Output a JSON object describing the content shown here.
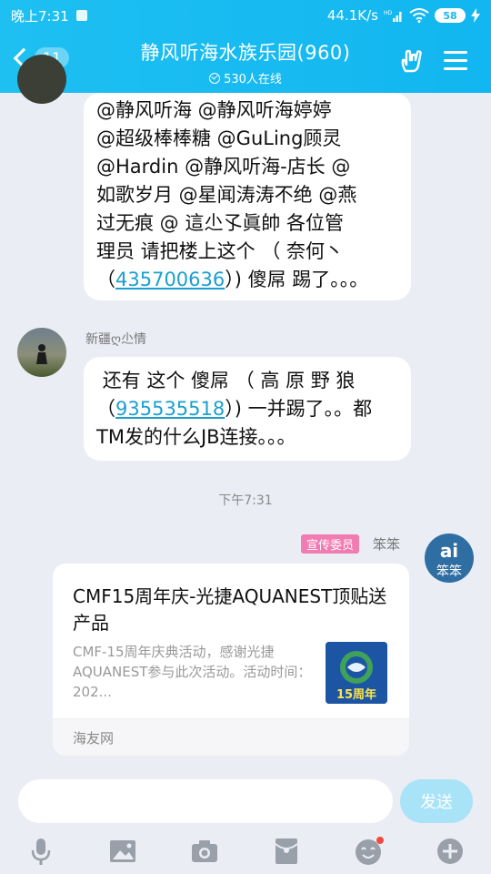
{
  "status_bar": {
    "time": "晚上7:31",
    "net_speed": "44.1K/s",
    "battery": "58"
  },
  "header": {
    "back_badge": "11",
    "title": "静风听海水族乐园(960)",
    "online": "530人在线"
  },
  "messages": [
    {
      "lines": [
        "@静风听海 @静风听海婷婷",
        "@超级棒棒糖 @GuLing顾灵",
        "@Hardin @静风听海-店长 @",
        "如歌岁月 @星闻涛涛不绝 @燕",
        "过无痕 @ 這尐孓眞帥   各位管",
        "理员 请把楼上这个 （ 奈何丶"
      ],
      "last_prefix": "（",
      "link": "435700636",
      "last_suffix": "）) 傻屌 踢了。。。"
    },
    {
      "sender": "新疆ღ尐情",
      "line1_prefix": "还有 这个 傻屌 （ 高 原 野 狼",
      "line2_prefix": "（",
      "link": "935535518",
      "line2_suffix": "）) 一并踢了。。都",
      "line3": "TM发的什么JB连接。。。"
    }
  ],
  "timestamp": "下午7:31",
  "share_message": {
    "role": "宣传委员",
    "sender": "笨笨",
    "title": "CMF15周年庆-光捷AQUANEST顶贴送产品",
    "description": "CMF-15周年庆典活动，感谢光捷AQUANEST参与此次活动。活动时间：202...",
    "thumb_text": "15周年",
    "source": "海友网"
  },
  "input": {
    "placeholder": "",
    "send_label": "发送"
  },
  "toolbar": [
    "mic-icon",
    "image-icon",
    "camera-icon",
    "red-packet-icon",
    "emoji-icon",
    "plus-icon"
  ],
  "colors": {
    "header": "#15b9f1",
    "background": "#eaedf4",
    "link": "#1a9fd0",
    "role_badge": "#f27bb2",
    "send_button": "#a9e3f8"
  }
}
